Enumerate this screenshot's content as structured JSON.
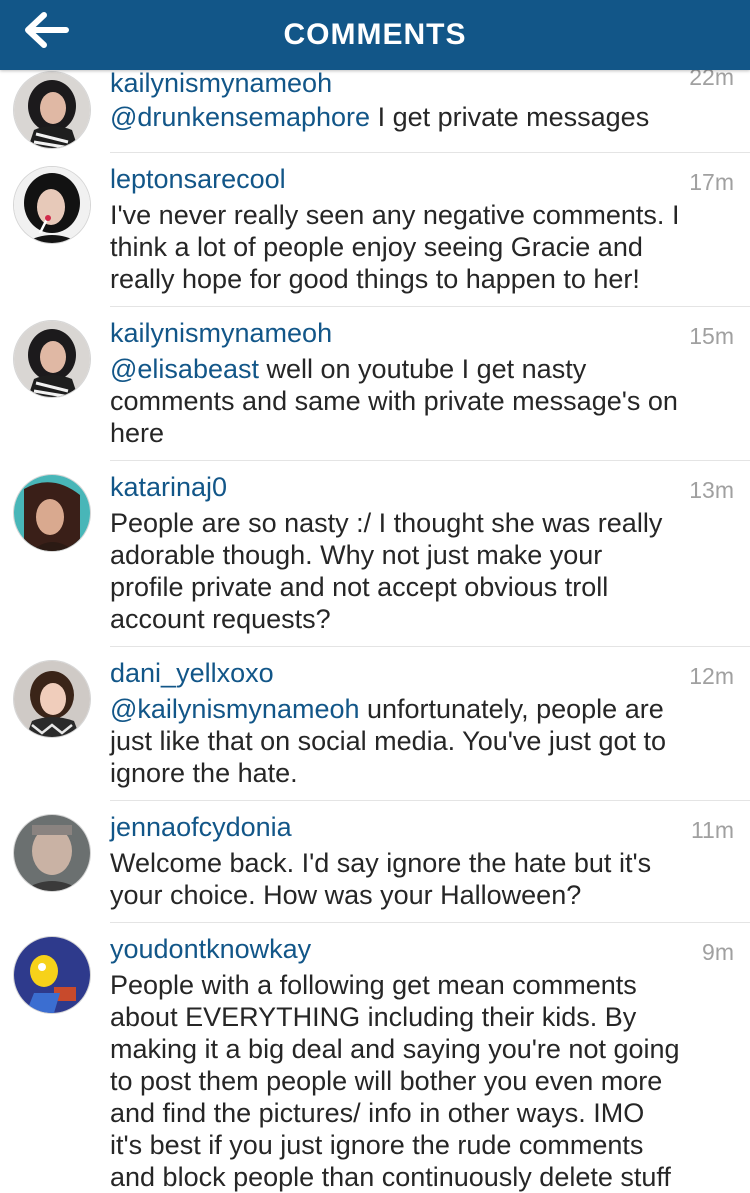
{
  "header": {
    "title": "COMMENTS",
    "background": "#125688",
    "back_icon": "arrow-left-icon"
  },
  "comments": [
    {
      "username": "kailynismynameoh",
      "time": "22m",
      "mention": "@drunkensemaphore",
      "text": " I get private messages"
    },
    {
      "username": "leptonsarecool",
      "time": "17m",
      "mention": "",
      "text": "I've never really seen any negative comments. I\nthink a lot of people enjoy seeing Gracie and\nreally hope for good things to happen to her!"
    },
    {
      "username": "kailynismynameoh",
      "time": "15m",
      "mention": "@elisabeast",
      "text": " well on youtube I get nasty\ncomments and same with private message's on\nhere"
    },
    {
      "username": "katarinaj0",
      "time": "13m",
      "mention": "",
      "text": "People are so nasty :/ I thought she was really\nadorable though. Why not just make your\nprofile private and not accept obvious troll\naccount requests?"
    },
    {
      "username": "dani_yellxoxo",
      "time": "12m",
      "mention": "@kailynismynameoh",
      "text": "  unfortunately, people are\njust like that on social media. You've just got to\nignore the hate."
    },
    {
      "username": "jennaofcydonia",
      "time": "11m",
      "mention": "",
      "text": "Welcome back. I'd say ignore the hate but it's\nyour choice. How was your Halloween?"
    },
    {
      "username": "youdontknowkay",
      "time": "9m",
      "mention": "",
      "text": "People with a following get mean comments\nabout EVERYTHING including their kids. By\nmaking it a big deal and saying you're not going\nto post them people will bother you even more\nand find the pictures/ info in other ways. IMO\nit's best if you just ignore the rude comments\nand block people than continuously delete stuff"
    }
  ],
  "colors": {
    "username": "#125688",
    "mention": "#125688",
    "body_text": "#262626",
    "timestamp": "#a0a0a0"
  }
}
